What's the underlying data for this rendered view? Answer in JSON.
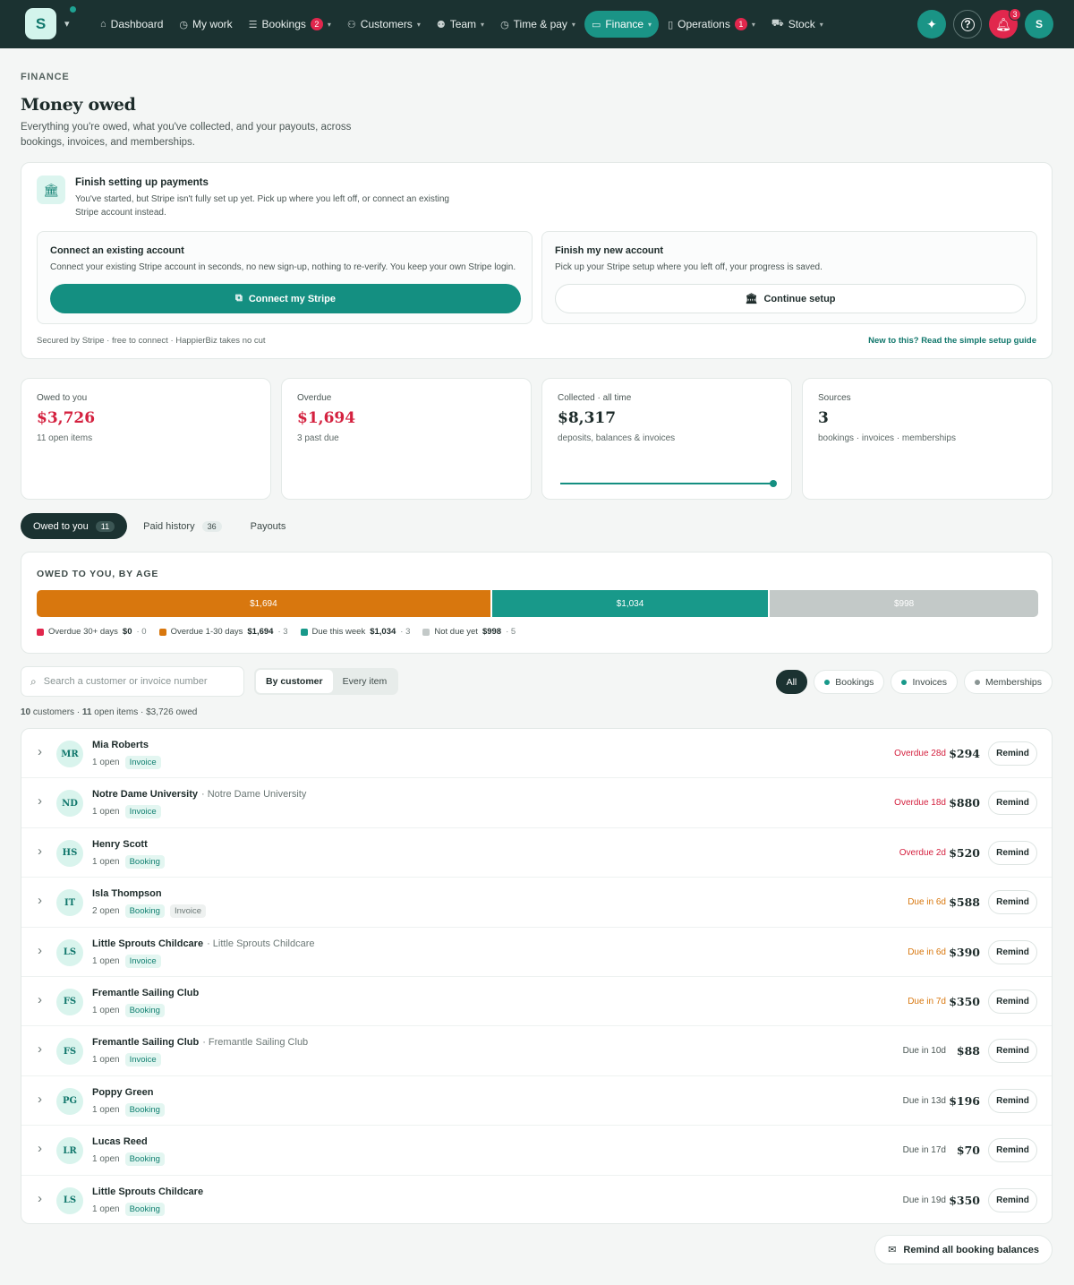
{
  "nav": {
    "logo_letter": "S",
    "items": [
      {
        "label": "Dashboard",
        "icon": "home-icon"
      },
      {
        "label": "My work",
        "icon": "clock-icon"
      },
      {
        "label": "Bookings",
        "icon": "list-icon",
        "badge": "2",
        "has_menu": true
      },
      {
        "label": "Customers",
        "icon": "users-icon",
        "has_menu": true
      },
      {
        "label": "Team",
        "icon": "team-icon",
        "has_menu": true
      },
      {
        "label": "Time & pay",
        "icon": "clock-icon",
        "has_menu": true
      },
      {
        "label": "Finance",
        "icon": "card-icon",
        "has_menu": true,
        "active": true
      },
      {
        "label": "Operations",
        "icon": "clipboard-icon",
        "badge": "1",
        "has_menu": true
      },
      {
        "label": "Stock",
        "icon": "cart-icon",
        "has_menu": true
      }
    ],
    "notification_count": "3",
    "avatar_letter": "S"
  },
  "header": {
    "eyebrow": "FINANCE",
    "title": "Money owed",
    "subtitle": "Everything you're owed, what you've collected, and your payouts, across bookings, invoices, and memberships."
  },
  "setup": {
    "title": "Finish setting up payments",
    "description": "You've started, but Stripe isn't fully set up yet. Pick up where you left off, or connect an existing Stripe account instead.",
    "connect": {
      "title": "Connect an existing account",
      "description": "Connect your existing Stripe account in seconds, no new sign-up, nothing to re-verify. You keep your own Stripe login.",
      "button": "Connect my Stripe"
    },
    "finish": {
      "title": "Finish my new account",
      "description": "Pick up your Stripe setup where you left off, your progress is saved.",
      "button": "Continue setup"
    },
    "footer": "Secured by Stripe · free to connect · HappierBiz takes no cut",
    "guide_link": "New to this? Read the simple setup guide"
  },
  "stats": [
    {
      "label": "Owed to you",
      "value": "$3,726",
      "sub": "11 open items",
      "color": "#d4213f"
    },
    {
      "label": "Overdue",
      "value": "$1,694",
      "sub": "3 past due",
      "color": "#d4213f"
    },
    {
      "label": "Collected · all time",
      "value": "$8,317",
      "sub": "deposits, balances & invoices",
      "color": "#1d2b2a",
      "progress": 1.0
    },
    {
      "label": "Sources",
      "value": "3",
      "sub": "bookings · invoices · memberships",
      "color": "#1d2b2a"
    }
  ],
  "tabs": [
    {
      "label": "Owed to you",
      "count": "11",
      "active": true
    },
    {
      "label": "Paid history",
      "count": "36"
    },
    {
      "label": "Payouts",
      "count": ""
    }
  ],
  "age": {
    "heading": "OWED TO YOU, BY AGE",
    "segments": [
      {
        "label": "$1,694",
        "value": 1694,
        "color": "#d8770e"
      },
      {
        "label": "$1,034",
        "value": 1034,
        "color": "#18998a"
      },
      {
        "label": "$998",
        "value": 998,
        "color": "#c3c9c8"
      }
    ],
    "legend": [
      {
        "label": "Overdue 30+ days",
        "amount": "$0",
        "count": "· 0",
        "color": "#e1274d"
      },
      {
        "label": "Overdue 1-30 days",
        "amount": "$1,694",
        "count": "· 3",
        "color": "#d8770e"
      },
      {
        "label": "Due this week",
        "amount": "$1,034",
        "count": "· 3",
        "color": "#18998a"
      },
      {
        "label": "Not due yet",
        "amount": "$998",
        "count": "· 5",
        "color": "#c3c9c8"
      }
    ]
  },
  "toolbar": {
    "search_placeholder": "Search a customer or invoice number",
    "view_by_customer": "By customer",
    "view_every_item": "Every item",
    "filters": [
      {
        "label": "All",
        "active": true,
        "dot": ""
      },
      {
        "label": "Bookings",
        "dot": "#18998a"
      },
      {
        "label": "Invoices",
        "dot": "#18998a"
      },
      {
        "label": "Memberships",
        "dot": "#8a9594"
      }
    ]
  },
  "summary": {
    "customers": "10",
    "customers_label": "customers ·",
    "items": "11",
    "items_label": "open items · $3,726 owed"
  },
  "rows": [
    {
      "initials": "MR",
      "name": "Mia Roberts",
      "org": "",
      "open": "1 open",
      "tags": [
        "Invoice"
      ],
      "due": "Overdue 28d",
      "due_color": "#d4213f",
      "amount": "$294"
    },
    {
      "initials": "ND",
      "name": "Notre Dame University",
      "org": "· Notre Dame University",
      "open": "1 open",
      "tags": [
        "Invoice"
      ],
      "due": "Overdue 18d",
      "due_color": "#d4213f",
      "amount": "$880"
    },
    {
      "initials": "HS",
      "name": "Henry Scott",
      "org": "",
      "open": "1 open",
      "tags": [
        "Booking"
      ],
      "due": "Overdue 2d",
      "due_color": "#d4213f",
      "amount": "$520"
    },
    {
      "initials": "IT",
      "name": "Isla Thompson",
      "org": "",
      "open": "2 open",
      "tags": [
        "Booking",
        "Invoice"
      ],
      "due": "Due in 6d",
      "due_color": "#d8770e",
      "amount": "$588"
    },
    {
      "initials": "LS",
      "name": "Little Sprouts Childcare",
      "org": "· Little Sprouts Childcare",
      "open": "1 open",
      "tags": [
        "Invoice"
      ],
      "due": "Due in 6d",
      "due_color": "#d8770e",
      "amount": "$390"
    },
    {
      "initials": "FS",
      "name": "Fremantle Sailing Club",
      "org": "",
      "open": "1 open",
      "tags": [
        "Booking"
      ],
      "due": "Due in 7d",
      "due_color": "#d8770e",
      "amount": "$350"
    },
    {
      "initials": "FS",
      "name": "Fremantle Sailing Club",
      "org": "· Fremantle Sailing Club",
      "open": "1 open",
      "tags": [
        "Invoice"
      ],
      "due": "Due in 10d",
      "due_color": "#4b5755",
      "amount": "$88"
    },
    {
      "initials": "PG",
      "name": "Poppy Green",
      "org": "",
      "open": "1 open",
      "tags": [
        "Booking"
      ],
      "due": "Due in 13d",
      "due_color": "#4b5755",
      "amount": "$196"
    },
    {
      "initials": "LR",
      "name": "Lucas Reed",
      "org": "",
      "open": "1 open",
      "tags": [
        "Booking"
      ],
      "due": "Due in 17d",
      "due_color": "#4b5755",
      "amount": "$70"
    },
    {
      "initials": "LS",
      "name": "Little Sprouts Childcare",
      "org": "",
      "open": "1 open",
      "tags": [
        "Booking"
      ],
      "due": "Due in 19d",
      "due_color": "#4b5755",
      "amount": "$350"
    }
  ],
  "remind_label": "Remind",
  "remind_all_label": "Remind all booking balances"
}
